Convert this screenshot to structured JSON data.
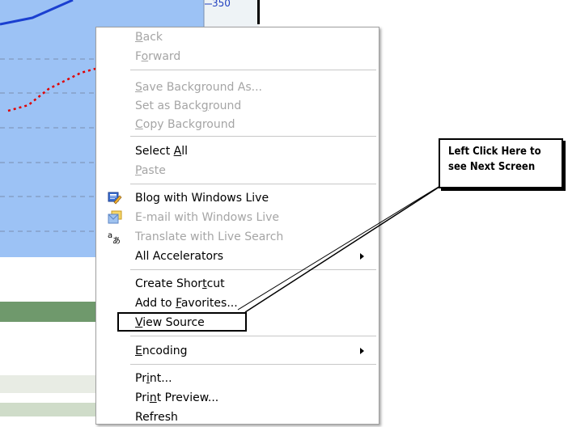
{
  "background": {
    "axis_tick_label": "350",
    "colors": {
      "chart_fill": "#9cc2f5",
      "green_band": "#6f996c",
      "line_series": "#1a3fd0",
      "dotted_series": "#e00000"
    }
  },
  "context_menu": {
    "items": [
      {
        "id": "back",
        "pre": "",
        "mnemonic": "B",
        "post": "ack",
        "enabled": false,
        "icon": ""
      },
      {
        "id": "forward",
        "pre": "F",
        "mnemonic": "o",
        "post": "rward",
        "enabled": false,
        "icon": ""
      },
      {
        "id": "save-background-as",
        "pre": "",
        "mnemonic": "S",
        "post": "ave Background As...",
        "enabled": false,
        "icon": ""
      },
      {
        "id": "set-as-background",
        "pre": "Set as Back",
        "mnemonic": "g",
        "post": "round",
        "enabled": false,
        "icon": ""
      },
      {
        "id": "copy-background",
        "pre": "",
        "mnemonic": "C",
        "post": "opy Background",
        "enabled": false,
        "icon": ""
      },
      {
        "id": "select-all",
        "pre": "Select ",
        "mnemonic": "A",
        "post": "ll",
        "enabled": true,
        "icon": ""
      },
      {
        "id": "paste",
        "pre": "",
        "mnemonic": "P",
        "post": "aste",
        "enabled": false,
        "icon": ""
      },
      {
        "id": "blog-with-windows-live",
        "pre": "Blog with Windows Live",
        "mnemonic": "",
        "post": "",
        "enabled": true,
        "icon": "blog-icon"
      },
      {
        "id": "email-with-windows-live",
        "pre": "E-mail with Windows Live",
        "mnemonic": "",
        "post": "",
        "enabled": false,
        "icon": "email-icon"
      },
      {
        "id": "translate-with-live-search",
        "pre": "Translate with Live Search",
        "mnemonic": "",
        "post": "",
        "enabled": false,
        "icon": "translate-icon"
      },
      {
        "id": "all-accelerators",
        "pre": "All Accelerators",
        "mnemonic": "",
        "post": "",
        "enabled": true,
        "icon": "",
        "submenu": true
      },
      {
        "id": "create-shortcut",
        "pre": "Create Shor",
        "mnemonic": "t",
        "post": "cut",
        "enabled": true,
        "icon": ""
      },
      {
        "id": "add-to-favorites",
        "pre": "Add to ",
        "mnemonic": "F",
        "post": "avorites...",
        "enabled": true,
        "icon": ""
      },
      {
        "id": "view-source",
        "pre": "",
        "mnemonic": "V",
        "post": "iew Source",
        "enabled": true,
        "icon": ""
      },
      {
        "id": "encoding",
        "pre": "",
        "mnemonic": "E",
        "post": "ncoding",
        "enabled": true,
        "icon": "",
        "submenu": true
      },
      {
        "id": "print",
        "pre": "Pr",
        "mnemonic": "i",
        "post": "nt...",
        "enabled": true,
        "icon": ""
      },
      {
        "id": "print-preview",
        "pre": "Pri",
        "mnemonic": "n",
        "post": "t Preview...",
        "enabled": true,
        "icon": ""
      },
      {
        "id": "refresh",
        "pre": "Refresh",
        "mnemonic": "",
        "post": "",
        "enabled": true,
        "icon": ""
      }
    ]
  },
  "callout": {
    "line1": "Left Click Here to",
    "line2": "see Next Screen"
  }
}
